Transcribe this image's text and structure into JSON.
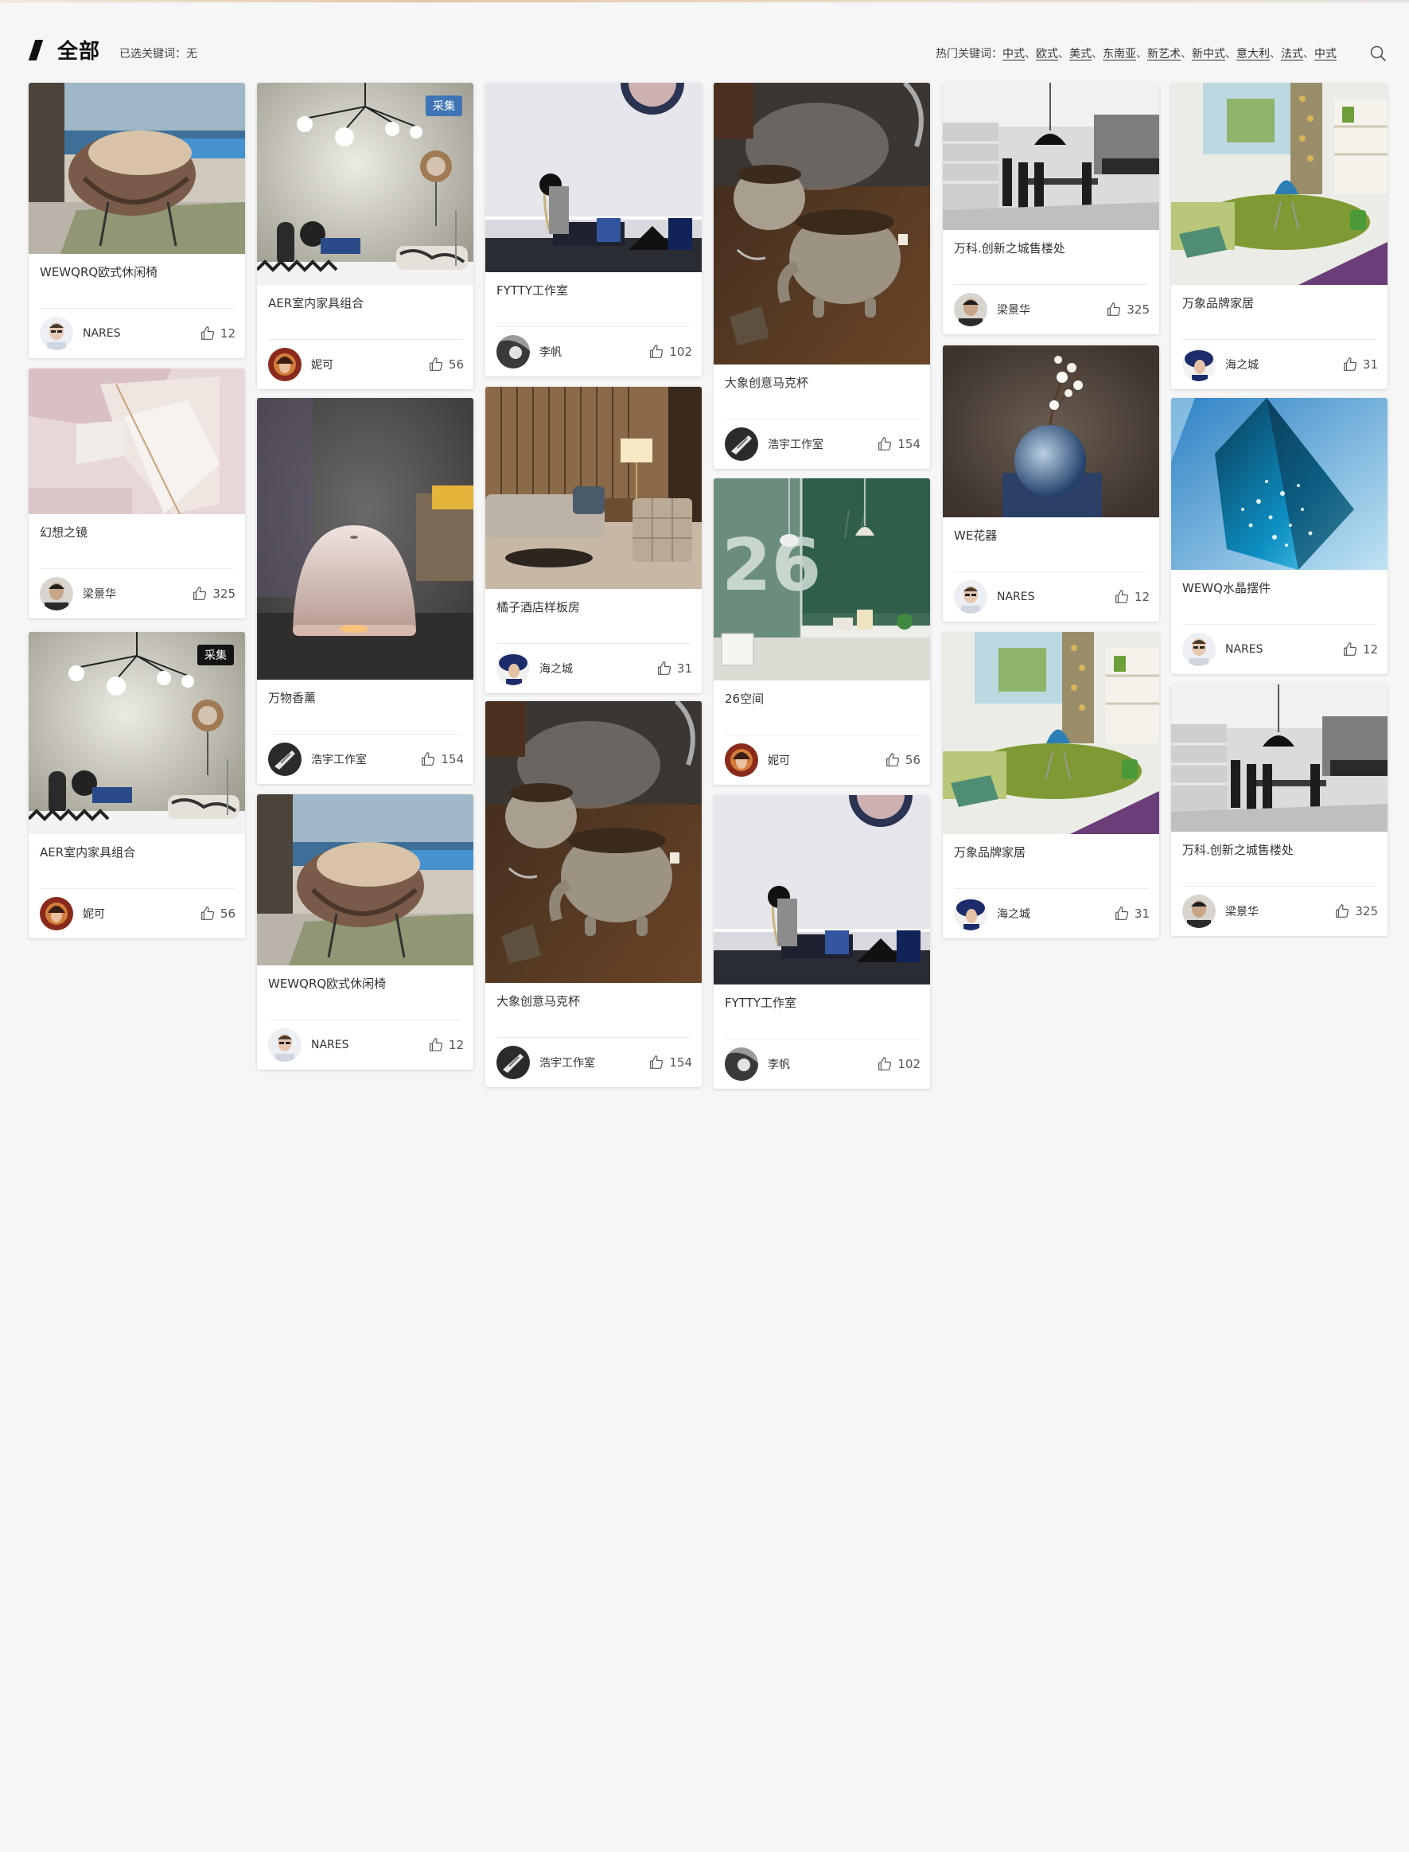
{
  "header": {
    "title": "全部",
    "selected_label": "已选关键词：无",
    "hot_label": "热门关键词：",
    "hot_keywords": [
      "中式",
      "欧式",
      "美式",
      "东南亚",
      "新艺术",
      "新中式",
      "意大利",
      "法式",
      "中式"
    ],
    "hot_separator": "、"
  },
  "cards": [
    {
      "title": "WEWQRQ欧式休闲椅",
      "author": "NARES",
      "likes": "12",
      "image": "chair",
      "avatar": "nares"
    },
    {
      "title": "幻想之镜",
      "author": "梁景华",
      "likes": "325",
      "image": "mirror",
      "avatar": "liang"
    },
    {
      "title": "AER室内家具组合",
      "author": "妮可",
      "likes": "56",
      "image": "aer",
      "avatar": "nike",
      "badge": "采集",
      "badge_style": "dark"
    },
    {
      "title": "AER室内家具组合",
      "author": "妮可",
      "likes": "56",
      "image": "aer",
      "avatar": "nike",
      "badge": "采集",
      "badge_style": "blue"
    },
    {
      "title": "万物香薰",
      "author": "浩宇工作室",
      "likes": "154",
      "image": "diffuser",
      "avatar": "haoyu"
    },
    {
      "title": "WEWQRQ欧式休闲椅",
      "author": "NARES",
      "likes": "12",
      "image": "chair",
      "avatar": "nares"
    },
    {
      "title": "FYTTY工作室",
      "author": "李帆",
      "likes": "102",
      "image": "studio",
      "avatar": "lifan"
    },
    {
      "title": "橘子酒店样板房",
      "author": "海之城",
      "likes": "31",
      "image": "hotel",
      "avatar": "hai"
    },
    {
      "title": "大象创意马克杯",
      "author": "浩宇工作室",
      "likes": "154",
      "image": "mug",
      "avatar": "haoyu"
    },
    {
      "title": "大象创意马克杯",
      "author": "浩宇工作室",
      "likes": "154",
      "image": "mug",
      "avatar": "haoyu"
    },
    {
      "title": "26空间",
      "author": "妮可",
      "likes": "56",
      "image": "space26",
      "avatar": "nike"
    },
    {
      "title": "FYTTY工作室",
      "author": "李帆",
      "likes": "102",
      "image": "studio",
      "avatar": "lifan"
    },
    {
      "title": "万科.创新之城售楼处",
      "author": "梁景华",
      "likes": "325",
      "image": "dining",
      "avatar": "liang"
    },
    {
      "title": "WE花器",
      "author": "NARES",
      "likes": "12",
      "image": "vase",
      "avatar": "nares"
    },
    {
      "title": "万象品牌家居",
      "author": "海之城",
      "likes": "31",
      "image": "living",
      "avatar": "hai"
    },
    {
      "title": "万象品牌家居",
      "author": "海之城",
      "likes": "31",
      "image": "living",
      "avatar": "hai"
    },
    {
      "title": "WEWQ水晶摆件",
      "author": "NARES",
      "likes": "12",
      "image": "crystal",
      "avatar": "nares"
    },
    {
      "title": "万科.创新之城售楼处",
      "author": "梁景华",
      "likes": "325",
      "image": "dining",
      "avatar": "liang"
    }
  ]
}
